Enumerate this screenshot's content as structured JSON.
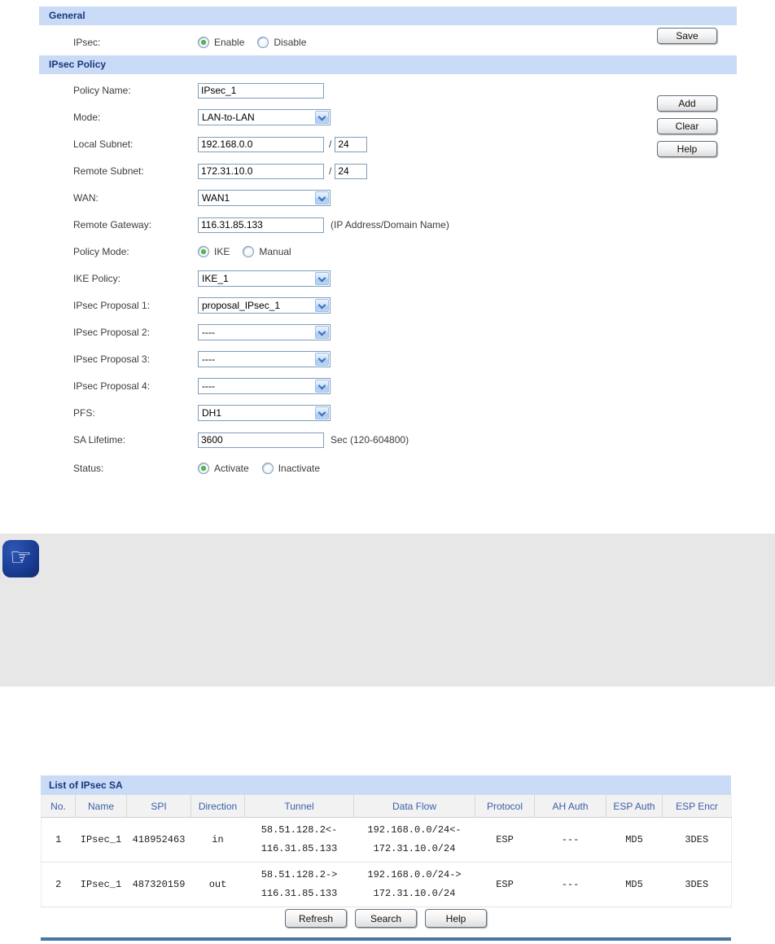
{
  "colors": {
    "section_bar_bg": "#c9dbf7",
    "section_title_text": "#17387d",
    "table_header_text": "#3a5fa8",
    "divider_blue": "#4d7aa4",
    "tips_icon_bg": "#1b3d96",
    "radio_selected_dot": "#2c8e2c"
  },
  "general": {
    "title": "General",
    "ipsec_label": "IPsec:",
    "options": [
      "Enable",
      "Disable"
    ],
    "selected": "Enable",
    "save_label": "Save"
  },
  "policy": {
    "title": "IPsec Policy",
    "policy_name": {
      "label": "Policy Name:",
      "value": "IPsec_1"
    },
    "mode": {
      "label": "Mode:",
      "value": "LAN-to-LAN"
    },
    "local_subnet": {
      "label": "Local Subnet:",
      "ip": "192.168.0.0",
      "separator": "/",
      "mask": "24"
    },
    "remote_subnet": {
      "label": "Remote Subnet:",
      "ip": "172.31.10.0",
      "separator": "/",
      "mask": "24"
    },
    "wan": {
      "label": "WAN:",
      "value": "WAN1"
    },
    "remote_gateway": {
      "label": "Remote Gateway:",
      "value": "116.31.85.133",
      "note": "(IP Address/Domain Name)"
    },
    "policy_mode": {
      "label": "Policy Mode:",
      "options": [
        "IKE",
        "Manual"
      ],
      "selected": "IKE"
    },
    "ike_policy": {
      "label": "IKE Policy:",
      "value": "IKE_1"
    },
    "proposal1": {
      "label": "IPsec Proposal 1:",
      "value": "proposal_IPsec_1"
    },
    "proposal2": {
      "label": "IPsec Proposal 2:",
      "value": "----"
    },
    "proposal3": {
      "label": "IPsec Proposal 3:",
      "value": "----"
    },
    "proposal4": {
      "label": "IPsec Proposal 4:",
      "value": "----"
    },
    "pfs": {
      "label": "PFS:",
      "value": "DH1"
    },
    "sa_lifetime": {
      "label": "SA Lifetime:",
      "value": "3600",
      "note": "Sec (120-604800)"
    },
    "status": {
      "label": "Status:",
      "options": [
        "Activate",
        "Inactivate"
      ],
      "selected": "Activate"
    },
    "buttons": {
      "add": "Add",
      "clear": "Clear",
      "help": "Help"
    }
  },
  "tips": {
    "icon_glyph": "☞"
  },
  "sa_table": {
    "title": "List of IPsec SA",
    "columns": [
      "No.",
      "Name",
      "SPI",
      "Direction",
      "Tunnel",
      "Data Flow",
      "Protocol",
      "AH Auth",
      "ESP Auth",
      "ESP Encr"
    ],
    "rows": [
      {
        "no": "1",
        "name": "IPsec_1",
        "spi": "418952463",
        "direction": "in",
        "tunnel_line1": "58.51.128.2<-",
        "tunnel_line2": "116.31.85.133",
        "dataflow_line1": "192.168.0.0/24<-",
        "dataflow_line2": "172.31.10.0/24",
        "protocol": "ESP",
        "ah_auth": "---",
        "esp_auth": "MD5",
        "esp_encr": "3DES"
      },
      {
        "no": "2",
        "name": "IPsec_1",
        "spi": "487320159",
        "direction": "out",
        "tunnel_line1": "58.51.128.2->",
        "tunnel_line2": "116.31.85.133",
        "dataflow_line1": "192.168.0.0/24->",
        "dataflow_line2": "172.31.10.0/24",
        "protocol": "ESP",
        "ah_auth": "---",
        "esp_auth": "MD5",
        "esp_encr": "3DES"
      }
    ],
    "buttons": {
      "refresh": "Refresh",
      "search": "Search",
      "help": "Help"
    }
  }
}
